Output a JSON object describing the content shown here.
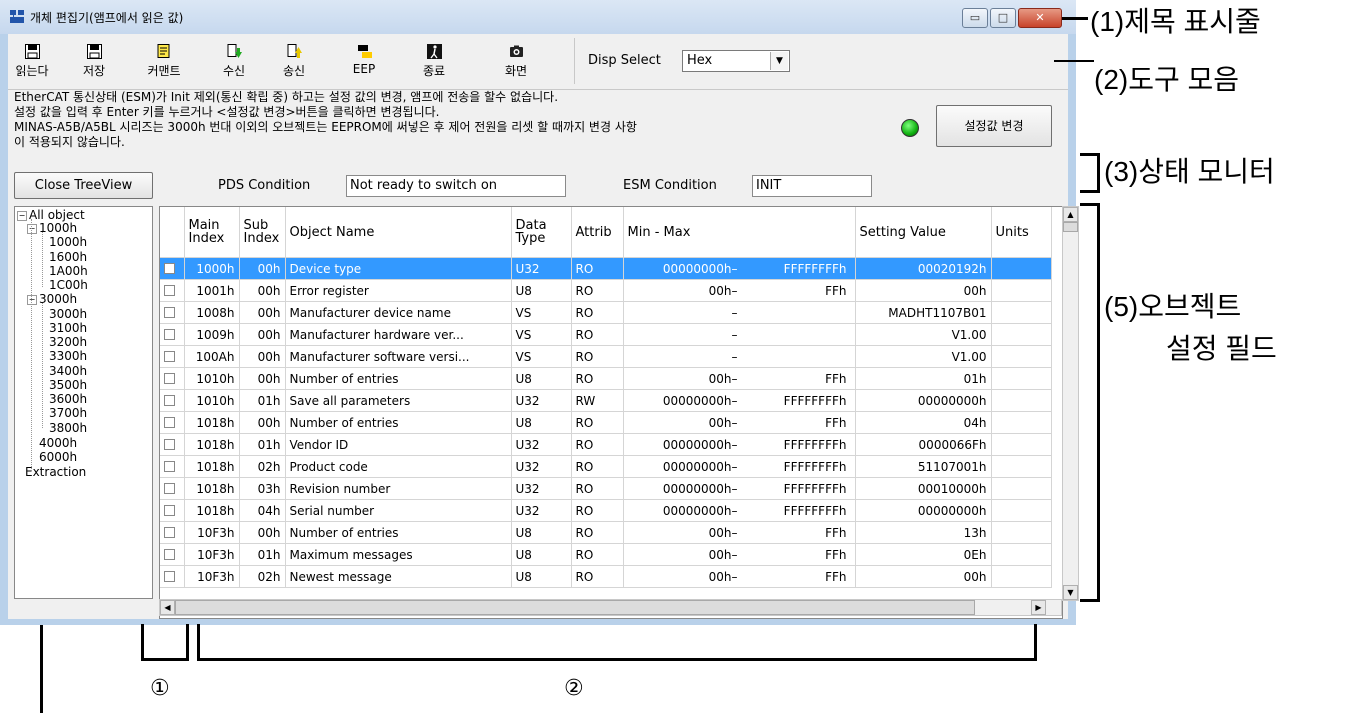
{
  "window": {
    "title": "개체 편집기(앰프에서 읽은 값)",
    "min_label": "▭",
    "max_label": "□",
    "close_label": "✕"
  },
  "toolbar": {
    "buttons": [
      {
        "label": "읽는다",
        "icon": "floppy-read-icon"
      },
      {
        "label": "저장",
        "icon": "floppy-save-icon"
      },
      {
        "label": "커맨트",
        "icon": "comment-icon"
      },
      {
        "label": "수신",
        "icon": "receive-icon"
      },
      {
        "label": "송신",
        "icon": "send-icon"
      },
      {
        "label": "EEP",
        "icon": "eeprom-icon"
      },
      {
        "label": "종료",
        "icon": "exit-icon"
      },
      {
        "label": "화면",
        "icon": "screenshot-icon"
      }
    ],
    "disp_select_label": "Disp Select",
    "disp_select_value": "Hex"
  },
  "message": {
    "line1": "EtherCAT 통신상태 (ESM)가 Init 제외(통신 확립 중) 하고는 설정 값의 변경, 앰프에 전송을 할수 없습니다.",
    "line2": "설정 값을 입력 후 Enter 키를 누르거나 <설정값 변경>버튼을 클릭하면 변경됩니다.",
    "line3": "MINAS-A5B/A5BL 시리즈는 3000h 번대 이외의 오브젝트는 EEPROM에 써넣은 후 제어 전원을 리셋 할 때까지 변경 사항",
    "line4": "이 적용되지 않습니다.",
    "apply_button": "설정값 변경",
    "led_color": "#10b010"
  },
  "status": {
    "close_tree_button": "Close TreeView",
    "pds_label": "PDS Condition",
    "pds_value": "Not ready to switch on",
    "esm_label": "ESM Condition",
    "esm_value": "INIT"
  },
  "tree": [
    {
      "label": "All object",
      "depth": 0,
      "expander": "⊟"
    },
    {
      "label": "1000h",
      "depth": 1,
      "expander": "⊟"
    },
    {
      "label": "1000h",
      "depth": 2
    },
    {
      "label": "1600h",
      "depth": 2
    },
    {
      "label": "1A00h",
      "depth": 2
    },
    {
      "label": "1C00h",
      "depth": 2
    },
    {
      "label": "3000h",
      "depth": 1,
      "expander": "⊟"
    },
    {
      "label": "3000h",
      "depth": 2
    },
    {
      "label": "3100h",
      "depth": 2
    },
    {
      "label": "3200h",
      "depth": 2
    },
    {
      "label": "3300h",
      "depth": 2
    },
    {
      "label": "3400h",
      "depth": 2
    },
    {
      "label": "3500h",
      "depth": 2
    },
    {
      "label": "3600h",
      "depth": 2
    },
    {
      "label": "3700h",
      "depth": 2
    },
    {
      "label": "3800h",
      "depth": 2
    },
    {
      "label": "4000h",
      "depth": 1
    },
    {
      "label": "6000h",
      "depth": 1
    },
    {
      "label": "Extraction",
      "depth": 0
    }
  ],
  "table": {
    "headers": {
      "main_index": "Main Index",
      "sub_index": "Sub Index",
      "object_name": "Object Name",
      "data_type": "Data Type",
      "attrib": "Attrib",
      "min_max": "Min - Max",
      "setting_value": "Setting Value",
      "units": "Units"
    },
    "rows": [
      {
        "main": "1000h",
        "sub": "00h",
        "name": "Device type",
        "type": "U32",
        "attrib": "RO",
        "min": "00000000h–",
        "max": "FFFFFFFFh",
        "value": "00020192h",
        "selected": true
      },
      {
        "main": "1001h",
        "sub": "00h",
        "name": "Error register",
        "type": "U8",
        "attrib": "RO",
        "min": "00h–",
        "max": "FFh",
        "value": "00h"
      },
      {
        "main": "1008h",
        "sub": "00h",
        "name": "Manufacturer device name",
        "type": "VS",
        "attrib": "RO",
        "min": "–",
        "max": "",
        "value": "MADHT1107B01"
      },
      {
        "main": "1009h",
        "sub": "00h",
        "name": "Manufacturer hardware ver...",
        "type": "VS",
        "attrib": "RO",
        "min": "–",
        "max": "",
        "value": "V1.00"
      },
      {
        "main": "100Ah",
        "sub": "00h",
        "name": "Manufacturer software versi...",
        "type": "VS",
        "attrib": "RO",
        "min": "–",
        "max": "",
        "value": "V1.00"
      },
      {
        "main": "1010h",
        "sub": "00h",
        "name": "Number of entries",
        "type": "U8",
        "attrib": "RO",
        "min": "00h–",
        "max": "FFh",
        "value": "01h"
      },
      {
        "main": "1010h",
        "sub": "01h",
        "name": "Save all parameters",
        "type": "U32",
        "attrib": "RW",
        "min": "00000000h–",
        "max": "FFFFFFFFh",
        "value": "00000000h"
      },
      {
        "main": "1018h",
        "sub": "00h",
        "name": "Number of entries",
        "type": "U8",
        "attrib": "RO",
        "min": "00h–",
        "max": "FFh",
        "value": "04h"
      },
      {
        "main": "1018h",
        "sub": "01h",
        "name": "Vendor ID",
        "type": "U32",
        "attrib": "RO",
        "min": "00000000h–",
        "max": "FFFFFFFFh",
        "value": "0000066Fh"
      },
      {
        "main": "1018h",
        "sub": "02h",
        "name": "Product code",
        "type": "U32",
        "attrib": "RO",
        "min": "00000000h–",
        "max": "FFFFFFFFh",
        "value": "51107001h"
      },
      {
        "main": "1018h",
        "sub": "03h",
        "name": "Revision number",
        "type": "U32",
        "attrib": "RO",
        "min": "00000000h–",
        "max": "FFFFFFFFh",
        "value": "00010000h"
      },
      {
        "main": "1018h",
        "sub": "04h",
        "name": "Serial number",
        "type": "U32",
        "attrib": "RO",
        "min": "00000000h–",
        "max": "FFFFFFFFh",
        "value": "00000000h"
      },
      {
        "main": "10F3h",
        "sub": "00h",
        "name": "Number of entries",
        "type": "U8",
        "attrib": "RO",
        "min": "00h–",
        "max": "FFh",
        "value": "13h"
      },
      {
        "main": "10F3h",
        "sub": "01h",
        "name": "Maximum messages",
        "type": "U8",
        "attrib": "RO",
        "min": "00h–",
        "max": "FFh",
        "value": "0Eh"
      },
      {
        "main": "10F3h",
        "sub": "02h",
        "name": "Newest message",
        "type": "U8",
        "attrib": "RO",
        "min": "00h–",
        "max": "FFh",
        "value": "00h"
      }
    ]
  },
  "callouts": {
    "title_bar": "(1)제목 표시줄",
    "toolbar": "(2)도구 모음",
    "status_monitor": "(3)상태 모니터",
    "object_field_1": "(5)오브젝트",
    "object_field_2": "설정 필드",
    "circle_1": "①",
    "circle_2": "②"
  }
}
